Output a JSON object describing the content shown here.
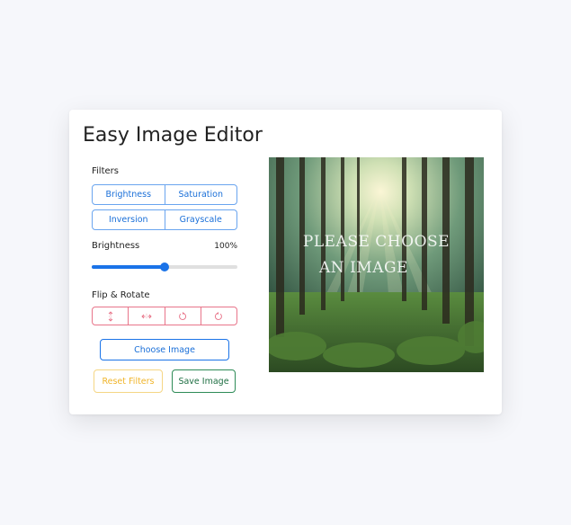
{
  "title": "Easy Image Editor",
  "filters": {
    "label": "Filters",
    "buttons": [
      "Brightness",
      "Saturation",
      "Inversion",
      "Grayscale"
    ]
  },
  "slider": {
    "name": "Brightness",
    "value_text": "100%",
    "fill_fraction": 0.5
  },
  "flip_rotate": {
    "label": "Flip & Rotate",
    "icons": [
      "flip-vertical-icon",
      "flip-horizontal-icon",
      "rotate-left-icon",
      "rotate-right-icon"
    ]
  },
  "buttons": {
    "choose": "Choose Image",
    "reset": "Reset Filters",
    "save": "Save Image"
  },
  "preview": {
    "line1": "PLEASE CHOOSE",
    "line2": "AN IMAGE"
  },
  "colors": {
    "primary": "#1a73e8",
    "danger": "#e8758a",
    "warning": "#f0c24a",
    "success": "#2e8b57"
  }
}
